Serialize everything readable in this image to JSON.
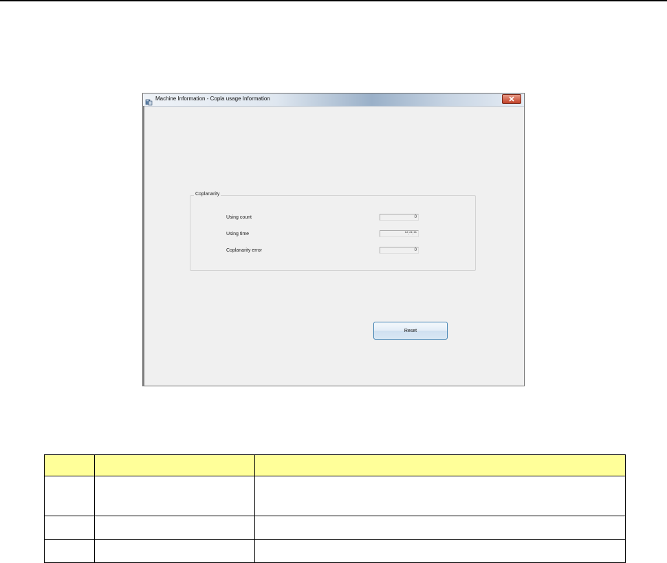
{
  "window": {
    "title": "Machine Information - Copla usage Information",
    "group_title": "Coplanarity",
    "fields": [
      {
        "label": "Using count",
        "value": "0"
      },
      {
        "label": "Using time",
        "value": "**:**:**"
      },
      {
        "label": "Coplanarity error",
        "value": "0"
      }
    ],
    "reset_label": "Reset"
  },
  "table": {
    "header": [
      "",
      "",
      ""
    ],
    "rows": [
      [
        "",
        "",
        ""
      ],
      [
        "",
        "",
        ""
      ],
      [
        "",
        "",
        ""
      ]
    ],
    "header_color": "#ffff99"
  },
  "colors": {
    "accent": "#3c7fb1",
    "close": "#c2422a",
    "dialog_bg": "#f0f0f0"
  }
}
